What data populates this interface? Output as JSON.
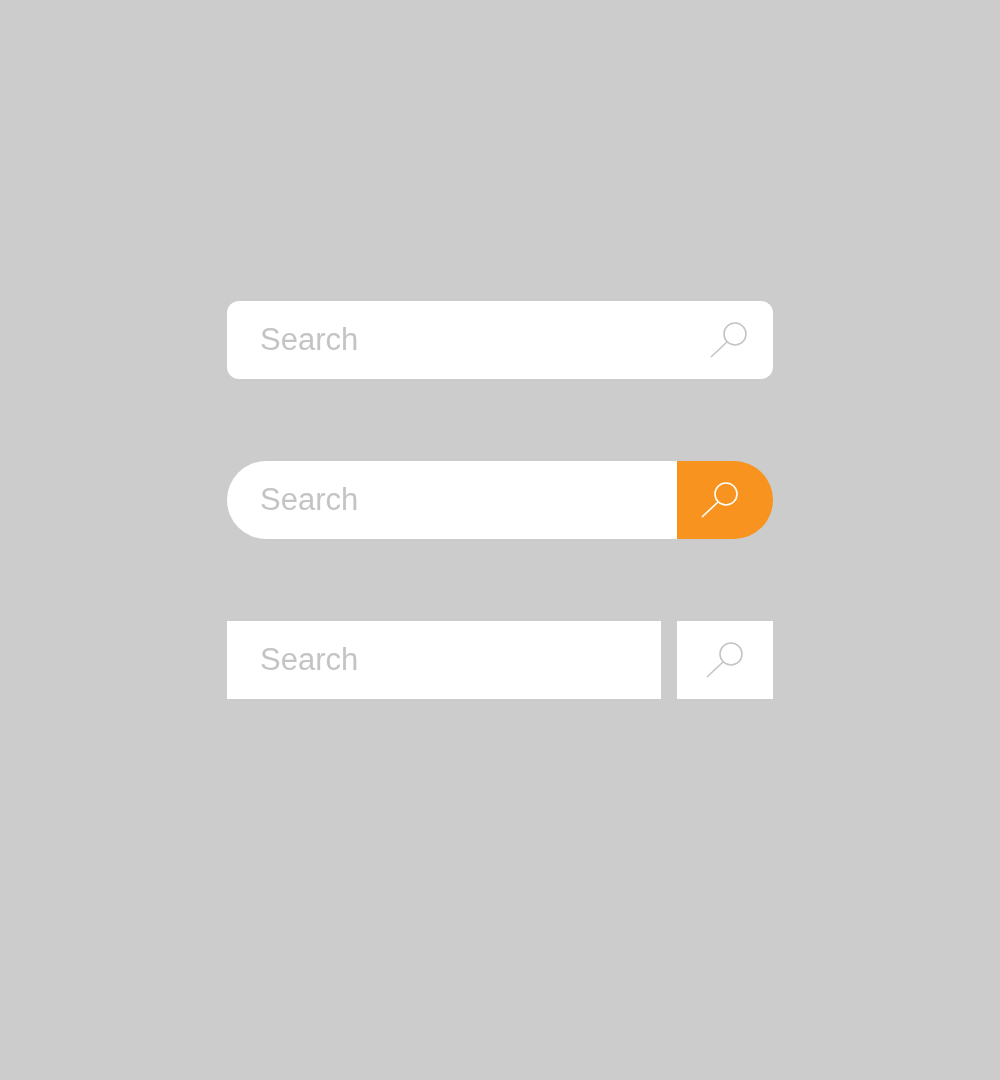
{
  "search_bars": [
    {
      "kind": "rounded",
      "placeholder": "Search"
    },
    {
      "kind": "pill",
      "placeholder": "Search"
    },
    {
      "kind": "split",
      "placeholder": "Search"
    }
  ]
}
